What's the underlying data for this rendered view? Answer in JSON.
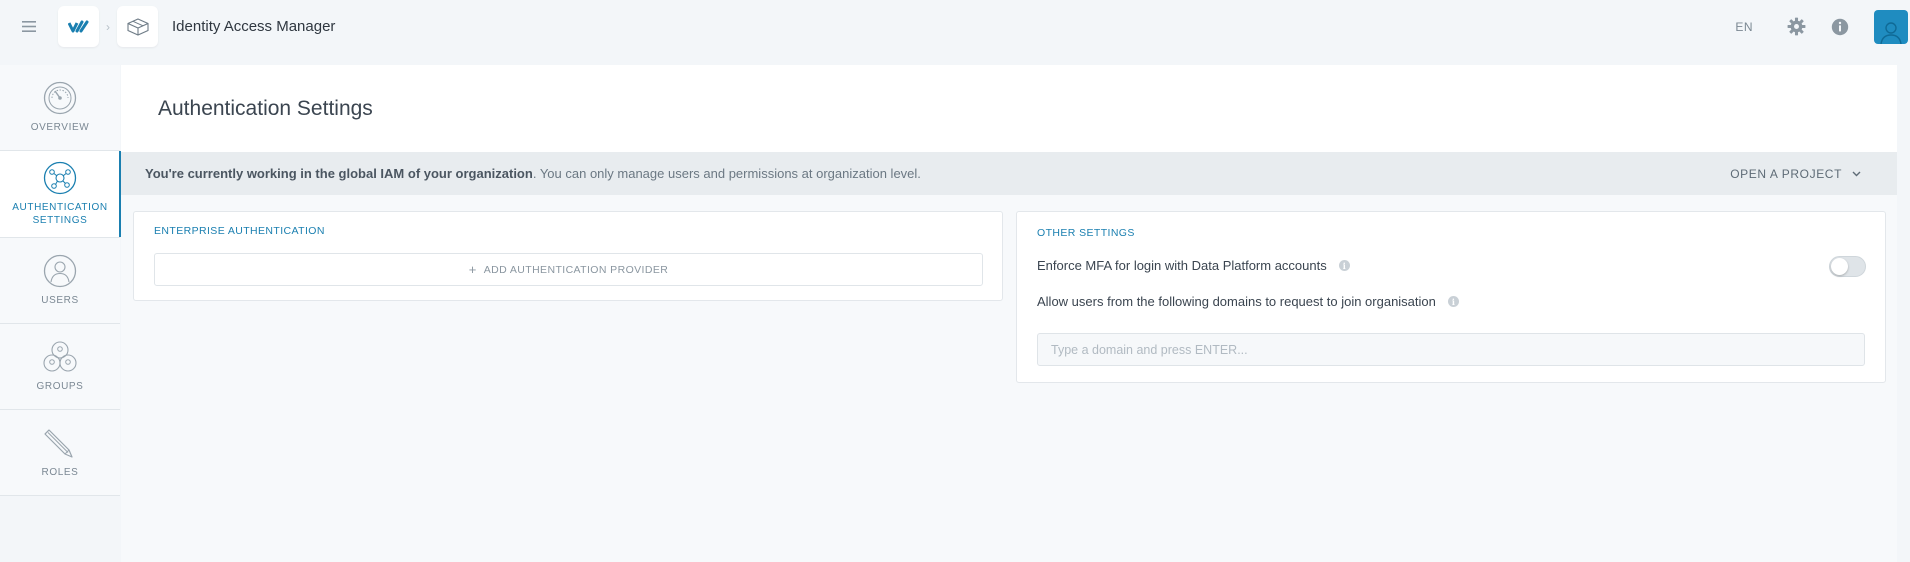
{
  "header": {
    "app_title": "Identity Access Manager",
    "language": "EN",
    "icons": {
      "menu": "hamburger-icon",
      "logo": "brand-logo-icon",
      "app": "cube-icon",
      "settings": "gear-icon",
      "info": "info-icon",
      "avatar": "user-avatar"
    }
  },
  "sidebar": {
    "items": [
      {
        "label": "OVERVIEW",
        "icon": "gauge-icon",
        "active": false
      },
      {
        "label": "AUTHENTICATION SETTINGS",
        "line1": "AUTHENTICATION",
        "line2": "SETTINGS",
        "icon": "network-icon",
        "active": true
      },
      {
        "label": "USERS",
        "icon": "user-icon",
        "active": false
      },
      {
        "label": "GROUPS",
        "icon": "group-icon",
        "active": false
      },
      {
        "label": "ROLES",
        "icon": "pencil-icon",
        "active": false
      }
    ]
  },
  "page": {
    "title": "Authentication Settings"
  },
  "notice": {
    "bold": "You're currently working in the global IAM of your organization",
    "rest": ". You can only manage users and permissions at organization level.",
    "action": "OPEN A PROJECT"
  },
  "enterprise_auth": {
    "title": "ENTERPRISE AUTHENTICATION",
    "add_button": "ADD AUTHENTICATION PROVIDER"
  },
  "other_settings": {
    "title": "OTHER SETTINGS",
    "mfa_label": "Enforce MFA for login with Data Platform accounts",
    "mfa_enabled": false,
    "domains_label": "Allow users from the following domains to request to join organisation",
    "domain_input": {
      "value": "",
      "placeholder": "Type a domain and press ENTER..."
    }
  },
  "colors": {
    "accent": "#1a7fb0",
    "avatar": "#1f8cc0",
    "background": "#f3f6f9"
  }
}
